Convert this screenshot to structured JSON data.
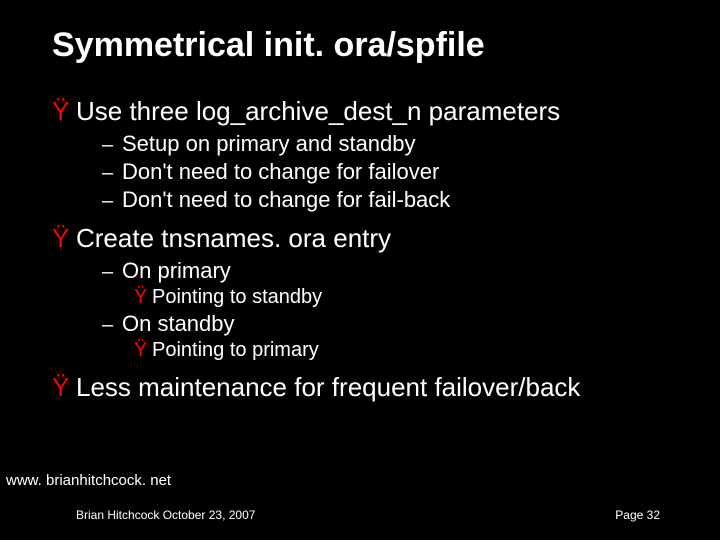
{
  "title": "Symmetrical init. ora/spfile",
  "bullets": [
    {
      "marker": "Ÿ",
      "text": "Use three log_archive_dest_n parameters",
      "subs": [
        {
          "dash": "–",
          "text": "Setup on primary and standby"
        },
        {
          "dash": "–",
          "text": "Don't need to change for failover"
        },
        {
          "dash": "–",
          "text": "Don't need to change for fail-back"
        }
      ]
    },
    {
      "marker": "Ÿ",
      "text": "Create tnsnames. ora entry",
      "subs": [
        {
          "dash": "–",
          "text": "On primary",
          "subsubs": [
            {
              "marker": "Ÿ",
              "text": "Pointing to standby"
            }
          ]
        },
        {
          "dash": "–",
          "text": "On standby",
          "subsubs": [
            {
              "marker": "Ÿ",
              "text": "Pointing to primary"
            }
          ]
        }
      ]
    },
    {
      "marker": "Ÿ",
      "text": "Less maintenance for frequent failover/back"
    }
  ],
  "footer": {
    "url": "www. brianhitchcock. net",
    "author": "Brian Hitchcock  October 23, 2007",
    "page": "Page 32"
  }
}
